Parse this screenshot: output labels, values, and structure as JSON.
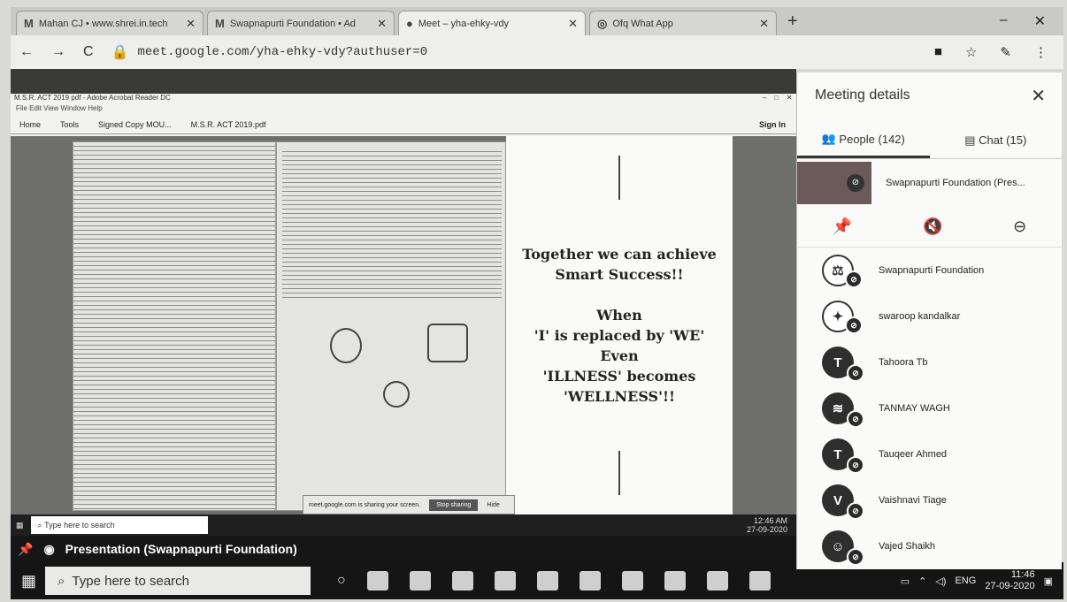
{
  "browser": {
    "tabs": [
      {
        "favicon": "M",
        "title": "Mahan CJ • www.shrei.in.tech"
      },
      {
        "favicon": "M",
        "title": "Swapnapurti Foundation • Ad"
      },
      {
        "favicon": "●",
        "title": "Meet – yha-ehky-vdy"
      },
      {
        "favicon": "◎",
        "title": "Ofq What App"
      }
    ],
    "new_tab": "+",
    "url": "meet.google.com/yha-ehky-vdy?authuser=0"
  },
  "acrobat": {
    "title": "M.S.R. ACT 2019 pdf - Adobe Acrobat Reader DC",
    "menu": "File  Edit  View  Window  Help",
    "tabs": [
      "Home",
      "Tools",
      "Signed Copy MOU...",
      "M.S.R. ACT 2019.pdf"
    ],
    "sign_in": "Sign In"
  },
  "slide": {
    "lines": [
      "Together we can achieve",
      "Smart Success!!",
      "",
      "When",
      "'I' is replaced by 'WE'",
      "Even",
      "'ILLNESS' becomes",
      "'WELLNESS'!!"
    ]
  },
  "meet_dialog": {
    "text": "meet.google.com is sharing your screen.",
    "stop": "Stop sharing",
    "hide": "Hide"
  },
  "inner_taskbar": {
    "search": "Type here to search",
    "time": "12:46 AM",
    "date": "27-09-2020"
  },
  "presentation_bar": {
    "label": "Presentation (Swapnapurti Foundation)"
  },
  "taskbar": {
    "search": "Type here to search",
    "lang": "ENG",
    "time": "11:46",
    "date": "27-09-2020"
  },
  "panel": {
    "title": "Meeting details",
    "people_tab": "People (142)",
    "chat_tab": "Chat (15)",
    "presenter": "Swapnapurti Foundation (Pres...",
    "people": [
      {
        "initial": "⚖",
        "name": "Swapnapurti Foundation"
      },
      {
        "initial": "✦",
        "name": "swaroop kandalkar"
      },
      {
        "initial": "T",
        "name": "Tahoora Tb"
      },
      {
        "initial": "≋",
        "name": "TANMAY WAGH"
      },
      {
        "initial": "T",
        "name": "Tauqeer Ahmed"
      },
      {
        "initial": "V",
        "name": "Vaishnavi Tiage"
      },
      {
        "initial": "☺",
        "name": "Vajed Shaikh"
      }
    ]
  }
}
